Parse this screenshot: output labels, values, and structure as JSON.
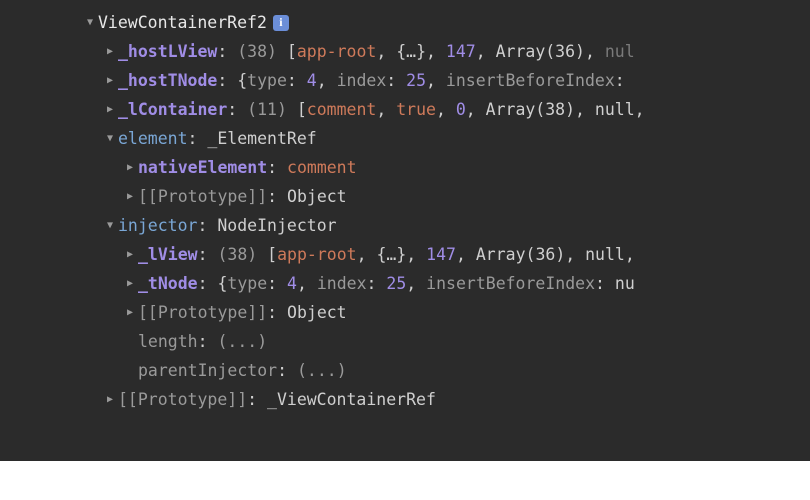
{
  "indent": {
    "l0": 82,
    "l1": 102,
    "l2": 122,
    "l3": 142
  },
  "root": {
    "name": "ViewContainerRef2",
    "info": "i"
  },
  "hostLView": {
    "key": "_hostLView",
    "count": "(38)",
    "v0": "app-root",
    "v1": "{…}",
    "v2": "147",
    "v3": "Array(36)",
    "v4": "nul"
  },
  "hostTNode": {
    "key": "_hostTNode",
    "k0": "type",
    "v0": "4",
    "k1": "index",
    "v1": "25",
    "k2": "insertBeforeIndex"
  },
  "lContainer": {
    "key": "_lContainer",
    "count": "(11)",
    "v0": "comment",
    "v1": "true",
    "v2": "0",
    "v3": "Array(38)",
    "v4": "null"
  },
  "element": {
    "key": "element",
    "type": "_ElementRef",
    "nativeKey": "nativeElement",
    "nativeVal": "comment"
  },
  "proto": {
    "key": "[[Prototype]]",
    "valObj": "Object",
    "valVCR": "_ViewContainerRef"
  },
  "injector": {
    "key": "injector",
    "type": "NodeInjector",
    "lViewKey": "_lView",
    "lViewCount": "(38)",
    "lv0": "app-root",
    "lv1": "{…}",
    "lv2": "147",
    "lv3": "Array(36)",
    "lv4": "null",
    "tNodeKey": "_tNode",
    "tk0": "type",
    "tv0": "4",
    "tk1": "index",
    "tv1": "25",
    "tk2": "insertBeforeIndex",
    "tv2": "nu"
  },
  "length": {
    "key": "length",
    "val": "(...)"
  },
  "parentInjector": {
    "key": "parentInjector",
    "val": "(...)"
  }
}
